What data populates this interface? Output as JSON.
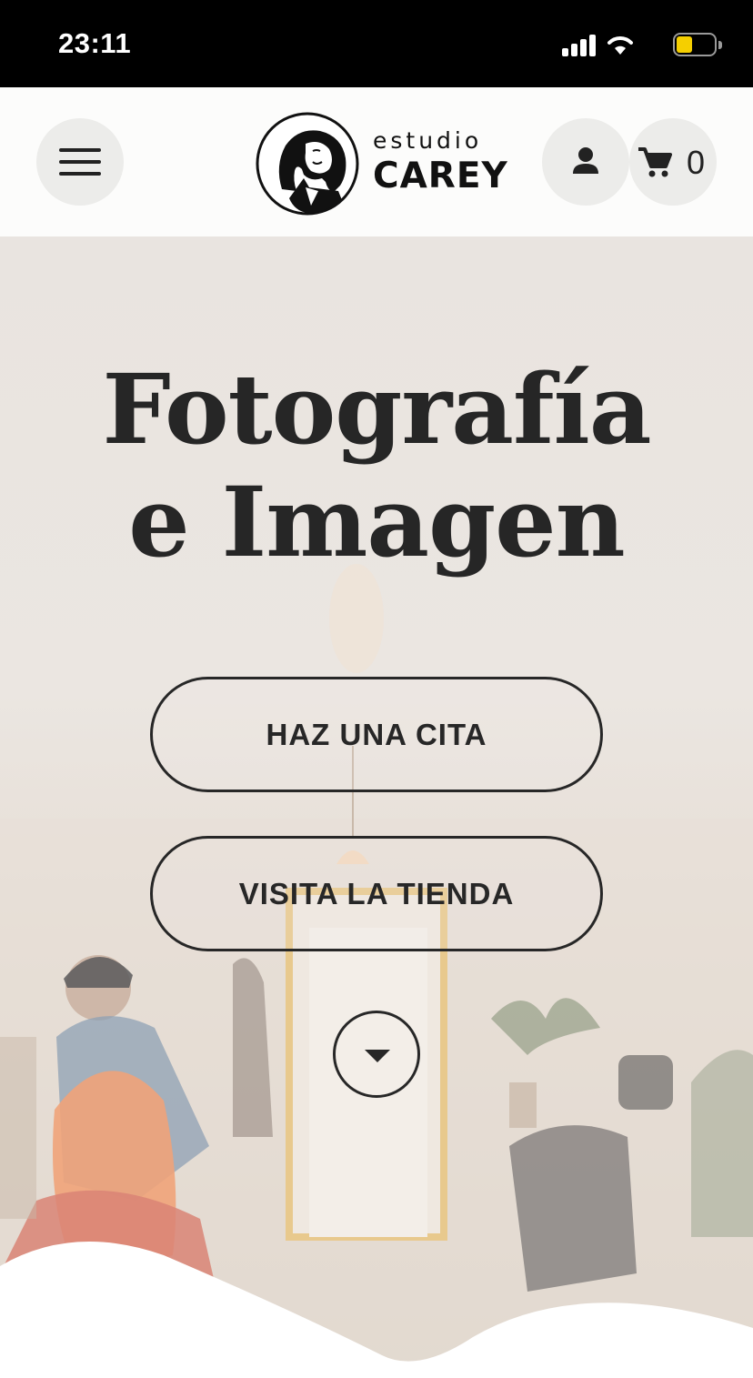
{
  "status_bar": {
    "time": "23:11"
  },
  "header": {
    "logo_line1": "estudio",
    "logo_line2": "CAREY",
    "cart_count": "0",
    "icons": {
      "menu": "hamburger-menu-icon",
      "account": "user-icon",
      "cart": "shopping-cart-icon"
    }
  },
  "hero": {
    "title_line1": "Fotografía",
    "title_line2": "e Imagen",
    "buttons": {
      "appointment": "HAZ UNA CITA",
      "shop": "VISITA LA TIENDA"
    },
    "scroll_icon": "chevron-down-icon"
  },
  "colors": {
    "text_dark": "#272727",
    "header_bg": "#fcfcfb",
    "icon_button_bg": "#ececea",
    "battery": "#f5cf00"
  }
}
